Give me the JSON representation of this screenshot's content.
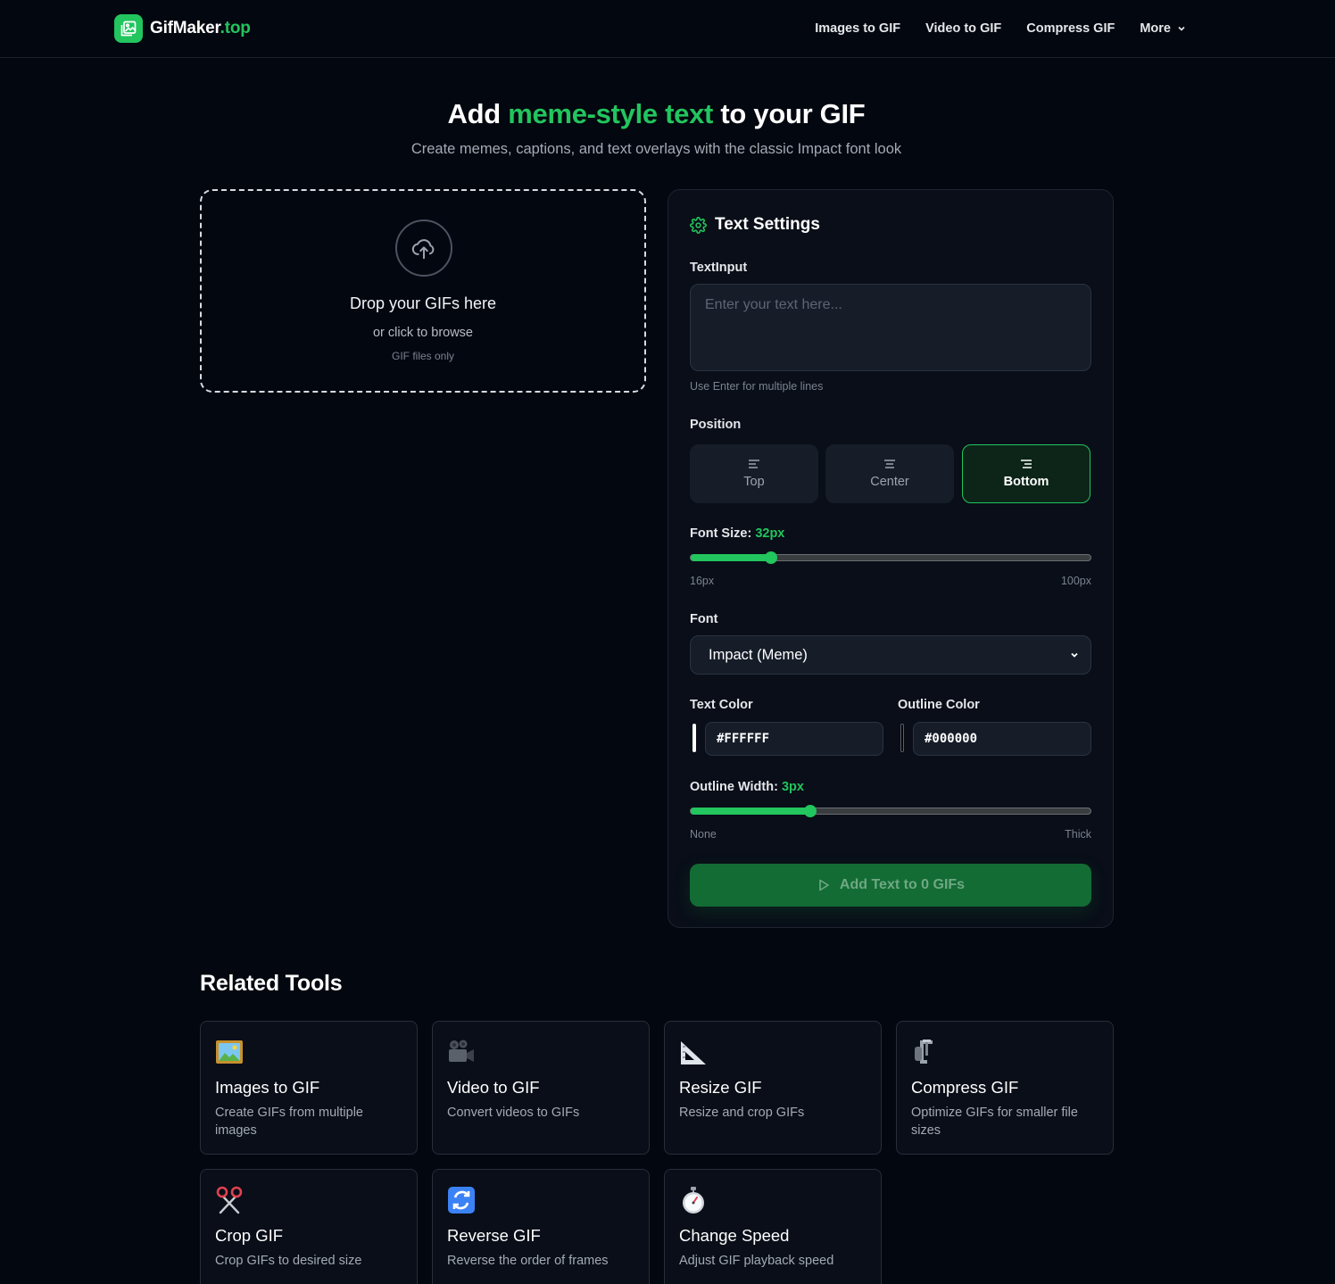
{
  "brand": {
    "name": "GifMaker",
    "tld": ".top",
    "accent": "#22c55e"
  },
  "nav": {
    "items": [
      "Images to GIF",
      "Video to GIF",
      "Compress GIF"
    ],
    "more_label": "More"
  },
  "hero": {
    "title_pre": "Add",
    "title_highlight": "meme-style text",
    "title_post": "to your GIF",
    "subtitle": "Create memes, captions, and text overlays with the classic Impact font look"
  },
  "dropzone": {
    "title": "Drop your GIFs here",
    "subtitle": "or click to browse",
    "note": "GIF files only"
  },
  "settings": {
    "title": "Text Settings",
    "text_input_label": "TextInput",
    "text_input_placeholder": "Enter your text here...",
    "text_input_value": "",
    "text_input_hint": "Use Enter for multiple lines",
    "position_label": "Position",
    "positions": [
      "Top",
      "Center",
      "Bottom"
    ],
    "position_selected": "Bottom",
    "font_size_label": "Font Size:",
    "font_size_value": "32px",
    "font_size_min": "16px",
    "font_size_max": "100px",
    "font_size_fraction": 0.2,
    "font_label": "Font",
    "font_selected": "Impact (Meme)",
    "text_color_label": "Text Color",
    "text_color_value": "#FFFFFF",
    "outline_color_label": "Outline Color",
    "outline_color_value": "#000000",
    "outline_width_label": "Outline Width:",
    "outline_width_value": "3px",
    "outline_min_label": "None",
    "outline_max_label": "Thick",
    "outline_fraction": 0.3,
    "submit_label": "Add Text to 0 GIFs"
  },
  "related": {
    "title": "Related Tools",
    "tools": [
      {
        "icon": "framed-picture-icon",
        "name": "Images to GIF",
        "desc": "Create GIFs from multiple images"
      },
      {
        "icon": "movie-camera-icon",
        "name": "Video to GIF",
        "desc": "Convert videos to GIFs"
      },
      {
        "icon": "triangular-ruler-icon",
        "name": "Resize GIF",
        "desc": "Resize and crop GIFs"
      },
      {
        "icon": "clamp-icon",
        "name": "Compress GIF",
        "desc": "Optimize GIFs for smaller file sizes"
      },
      {
        "icon": "scissors-icon",
        "name": "Crop GIF",
        "desc": "Crop GIFs to desired size"
      },
      {
        "icon": "reverse-arrows-icon",
        "name": "Reverse GIF",
        "desc": "Reverse the order of frames"
      },
      {
        "icon": "stopwatch-icon",
        "name": "Change Speed",
        "desc": "Adjust GIF playback speed"
      }
    ]
  }
}
